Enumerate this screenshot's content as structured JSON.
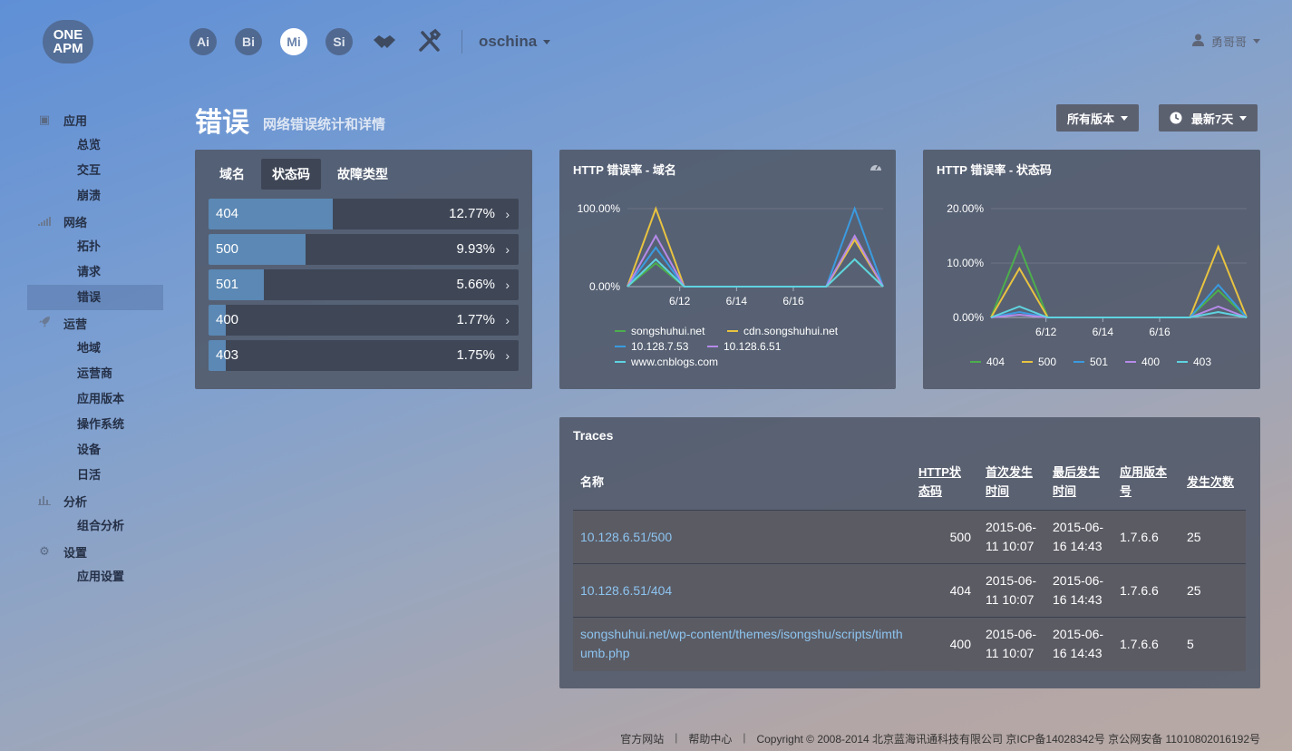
{
  "header": {
    "logo_text": [
      "ONE",
      "APM"
    ],
    "apps": [
      {
        "label": "Ai",
        "active": false
      },
      {
        "label": "Bi",
        "active": false
      },
      {
        "label": "Mi",
        "active": true
      },
      {
        "label": "Si",
        "active": false
      }
    ],
    "project": "oschina",
    "user": "勇哥哥"
  },
  "sidebar": {
    "groups": [
      {
        "label": "应用",
        "icon": "cube-icon",
        "items": [
          "总览",
          "交互",
          "崩溃"
        ]
      },
      {
        "label": "网络",
        "icon": "signal-icon",
        "items": [
          "拓扑",
          "请求",
          "错误"
        ]
      },
      {
        "label": "运营",
        "icon": "rocket-icon",
        "items": [
          "地域",
          "运营商",
          "应用版本",
          "操作系统",
          "设备",
          "日活"
        ]
      },
      {
        "label": "分析",
        "icon": "bar-chart-icon",
        "items": [
          "组合分析"
        ]
      },
      {
        "label": "设置",
        "icon": "gears-icon",
        "items": [
          "应用设置"
        ]
      }
    ],
    "active_item": "错误"
  },
  "page": {
    "title": "错误",
    "subtitle": "网络错误统计和详情",
    "version_filter": "所有版本",
    "time_filter": "最新7天"
  },
  "error_panel": {
    "tabs": [
      "域名",
      "状态码",
      "故障类型"
    ],
    "active_tab": "状态码",
    "rows": [
      {
        "code": "404",
        "value": "12.77%",
        "fraction": 0.1277
      },
      {
        "code": "500",
        "value": "9.93%",
        "fraction": 0.0993
      },
      {
        "code": "501",
        "value": "5.66%",
        "fraction": 0.0566
      },
      {
        "code": "400",
        "value": "1.77%",
        "fraction": 0.0177
      },
      {
        "code": "403",
        "value": "1.75%",
        "fraction": 0.0175
      }
    ]
  },
  "chart_data": [
    {
      "type": "line",
      "title": "HTTP 错误率 - 域名",
      "x": [
        "6/11",
        "6/11.5",
        "6/12",
        "6/13",
        "6/14",
        "6/15",
        "6/16",
        "6/16.5",
        "6/17",
        "6/17.5"
      ],
      "x_ticks": [
        "6/12",
        "6/14",
        "6/16"
      ],
      "y_ticks": [
        "100.00%",
        "0.00%"
      ],
      "ylim": [
        0,
        100
      ],
      "legend_placement": "bottom",
      "series": [
        {
          "name": "songshuhui.net",
          "color": "#4cae4c",
          "values": [
            0,
            30,
            0,
            0,
            0,
            0,
            0,
            0,
            35,
            0
          ]
        },
        {
          "name": "cdn.songshuhui.net",
          "color": "#e8c340",
          "values": [
            0,
            100,
            0,
            0,
            0,
            0,
            0,
            0,
            60,
            0
          ]
        },
        {
          "name": "10.128.7.53",
          "color": "#3a9be0",
          "values": [
            0,
            50,
            0,
            0,
            0,
            0,
            0,
            0,
            100,
            0
          ]
        },
        {
          "name": "10.128.6.51",
          "color": "#b58ae8",
          "values": [
            0,
            65,
            0,
            0,
            0,
            0,
            0,
            0,
            65,
            0
          ]
        },
        {
          "name": "www.cnblogs.com",
          "color": "#5fd3e0",
          "values": [
            0,
            35,
            0,
            0,
            0,
            0,
            0,
            0,
            35,
            0
          ]
        }
      ]
    },
    {
      "type": "line",
      "title": "HTTP 错误率 - 状态码",
      "x": [
        "6/11",
        "6/11.5",
        "6/12",
        "6/13",
        "6/14",
        "6/15",
        "6/16",
        "6/16.5",
        "6/17",
        "6/17.5"
      ],
      "x_ticks": [
        "6/12",
        "6/14",
        "6/16"
      ],
      "y_ticks": [
        "20.00%",
        "10.00%",
        "0.00%"
      ],
      "ylim": [
        0,
        20
      ],
      "legend_placement": "bottom",
      "series": [
        {
          "name": "404",
          "color": "#4cae4c",
          "values": [
            0,
            13,
            0,
            0,
            0,
            0,
            0,
            0,
            5,
            0
          ]
        },
        {
          "name": "500",
          "color": "#e8c340",
          "values": [
            0,
            9,
            0,
            0,
            0,
            0,
            0,
            0,
            13,
            0
          ]
        },
        {
          "name": "501",
          "color": "#3a9be0",
          "values": [
            0,
            1,
            0,
            0,
            0,
            0,
            0,
            0,
            6,
            0
          ]
        },
        {
          "name": "400",
          "color": "#b58ae8",
          "values": [
            0,
            0.5,
            0,
            0,
            0,
            0,
            0,
            0,
            2,
            0
          ]
        },
        {
          "name": "403",
          "color": "#5fd3e0",
          "values": [
            0,
            2,
            0,
            0,
            0,
            0,
            0,
            0,
            1,
            0
          ]
        }
      ]
    }
  ],
  "traces": {
    "title": "Traces",
    "headers": [
      "名称",
      "HTTP状态码",
      "首次发生时间",
      "最后发生时间",
      "应用版本号",
      "发生次数"
    ],
    "rows": [
      {
        "name": "10.128.6.51/500",
        "status": "500",
        "first": "2015-06-11 10:07",
        "last": "2015-06-16 14:43",
        "version": "1.7.6.6",
        "count": "25"
      },
      {
        "name": "10.128.6.51/404",
        "status": "404",
        "first": "2015-06-11 10:07",
        "last": "2015-06-16 14:43",
        "version": "1.7.6.6",
        "count": "25"
      },
      {
        "name": "songshuhui.net/wp-content/themes/isongshu/scripts/timthumb.php",
        "status": "400",
        "first": "2015-06-11 10:07",
        "last": "2015-06-16 14:43",
        "version": "1.7.6.6",
        "count": "5"
      }
    ]
  },
  "footer": {
    "site": "官方网站",
    "help": "帮助中心",
    "copyright": "Copyright © 2008-2014 北京蓝海讯通科技有限公司 京ICP备14028342号 京公网安备 11010802016192号"
  }
}
